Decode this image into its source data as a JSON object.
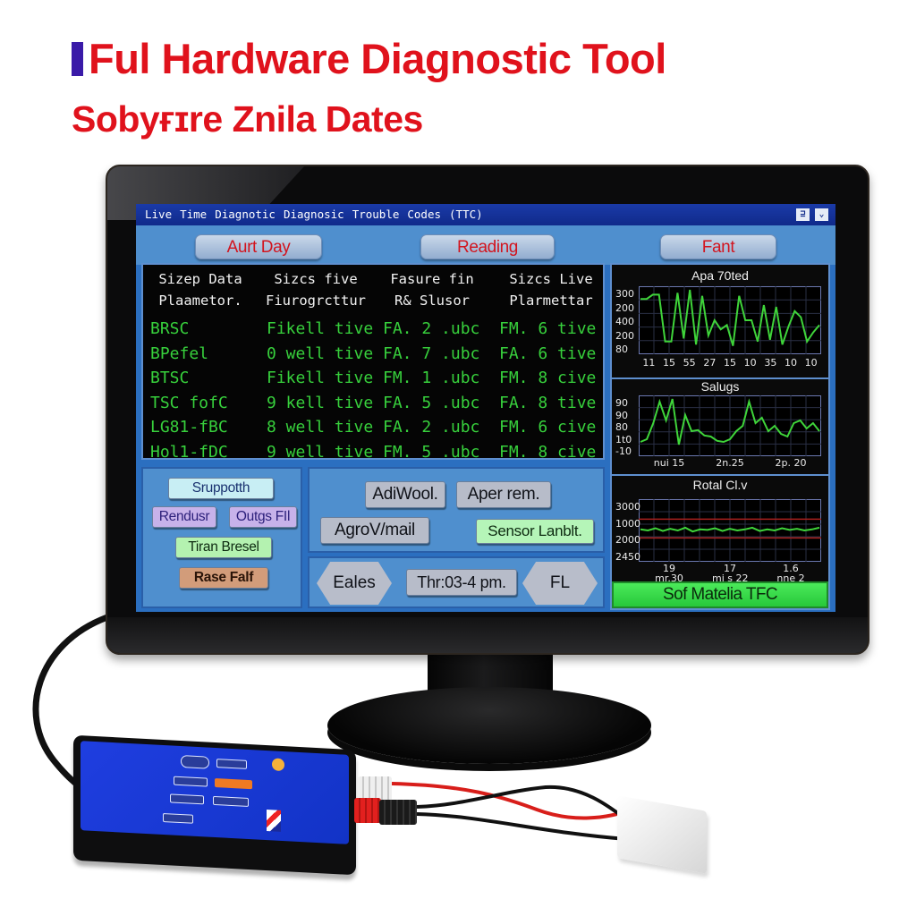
{
  "headline": {
    "line1": "Ful Hardware Diagnostic Tool",
    "line2": "Sobyғɪre Znila Dates"
  },
  "app": {
    "menu": [
      "Live",
      "Time",
      "Diagnotic",
      "Diagnosic",
      "Trouble",
      "Codes",
      "(TTC)"
    ],
    "window_controls": [
      {
        "icon": "minimize-restore-icon",
        "glyph": "⊒"
      },
      {
        "icon": "dropdown-icon",
        "glyph": "⌄"
      }
    ],
    "tabs": [
      {
        "label": "Aurt Day"
      },
      {
        "label": "Reading"
      },
      {
        "label": "Fant"
      }
    ]
  },
  "table": {
    "headers": [
      "Sizep Data\nPlaametоr.",
      "Sizcs five\nFiurogrcttur",
      "Fasure fin\nR& Slusor",
      "Sizcs Live\nPlarmettar"
    ],
    "rows": [
      [
        "BRSC",
        "Fikell tive",
        "FA. 2 .ubc",
        "FM. 6 tive"
      ],
      [
        "BPefel",
        "0 well tive",
        "FA. 7 .ubc",
        "FA. 6 tive"
      ],
      [
        "BTSC",
        "Fikell tive",
        "FM. 1 .ubc",
        "FM. 8 cive"
      ],
      [
        "TSC fofC",
        "9 kell tive",
        "FA. 5 .ubc",
        "FA. 8 tive"
      ],
      [
        "LG81-fBC",
        "8 well tive",
        "FA. 2 .ubc",
        "FM. 6 cive"
      ],
      [
        "Hol1-fDC",
        "9 well tive",
        "FM. 5 .ubc",
        "FM. 8 cive"
      ]
    ]
  },
  "left_panel": {
    "buttons": [
      "Sruppotth",
      "Rendusr",
      "Outgs FIl",
      "Tiran Bresel",
      "Rase Falf"
    ]
  },
  "mid_panel": {
    "buttons": [
      "AdiWool.",
      "Aper rem.",
      "AgroV/mail",
      "Sensor Lanblt."
    ]
  },
  "nav_panel": {
    "prev_label": "Eales",
    "time_label": "Thr:03-4 pm.",
    "next_label": "FL"
  },
  "status_button": {
    "label": "Sof Matelia TFC",
    "color": "#33d646"
  },
  "chart_data": [
    {
      "type": "line",
      "title": "Apa 70ted",
      "ytick_labels": [
        "300",
        "200",
        "400",
        "200",
        "80"
      ],
      "xtick_labels": [
        "11",
        "15",
        "55",
        "27",
        "15",
        "10",
        "35",
        "10",
        "10"
      ],
      "series": [
        {
          "name": "signal",
          "color": "#3fd43a",
          "values": [
            0.85,
            0.85,
            0.92,
            0.92,
            0.15,
            0.15,
            0.95,
            0.2,
            1.0,
            0.1,
            0.9,
            0.25,
            0.5,
            0.35,
            0.42,
            0.08,
            0.9,
            0.5,
            0.5,
            0.15,
            0.75,
            0.18,
            0.72,
            0.1,
            0.4,
            0.65,
            0.55,
            0.15,
            0.3,
            0.42
          ]
        }
      ],
      "ylim": [
        0,
        1
      ]
    },
    {
      "type": "line",
      "title": "Salugs",
      "ytick_labels": [
        "90",
        "90",
        "80",
        "1t0",
        "-10"
      ],
      "xtick_labels": [
        "nui 15",
        "2n.25",
        "2p. 20"
      ],
      "series": [
        {
          "name": "signal",
          "color": "#3fd43a",
          "values": [
            0.2,
            0.25,
            0.55,
            0.95,
            0.6,
            1.0,
            0.15,
            0.7,
            0.4,
            0.42,
            0.32,
            0.3,
            0.22,
            0.2,
            0.25,
            0.4,
            0.5,
            0.95,
            0.55,
            0.65,
            0.4,
            0.5,
            0.35,
            0.3,
            0.55,
            0.6,
            0.45,
            0.55,
            0.4
          ]
        }
      ],
      "ylim": [
        0,
        1
      ]
    },
    {
      "type": "line",
      "title": "Rotal Cl.v",
      "ytick_labels": [
        "3000",
        "1000",
        "2000",
        "2450"
      ],
      "xtick_labels": [
        "19\nmr.30",
        "17\nmi s 22",
        "1.6\nnne 2"
      ],
      "series": [
        {
          "name": "signal",
          "color": "#3fd43a",
          "values": [
            0.52,
            0.5,
            0.54,
            0.49,
            0.53,
            0.5,
            0.55,
            0.48,
            0.52,
            0.51,
            0.54,
            0.49,
            0.53,
            0.5,
            0.52,
            0.55,
            0.49,
            0.52,
            0.5,
            0.54,
            0.51,
            0.53,
            0.5,
            0.52,
            0.55
          ]
        }
      ],
      "reference_lines": [
        {
          "value": 0.68,
          "color": "#a8201e"
        },
        {
          "value": 0.38,
          "color": "#a8201e"
        }
      ],
      "ylim": [
        0,
        1
      ]
    }
  ]
}
